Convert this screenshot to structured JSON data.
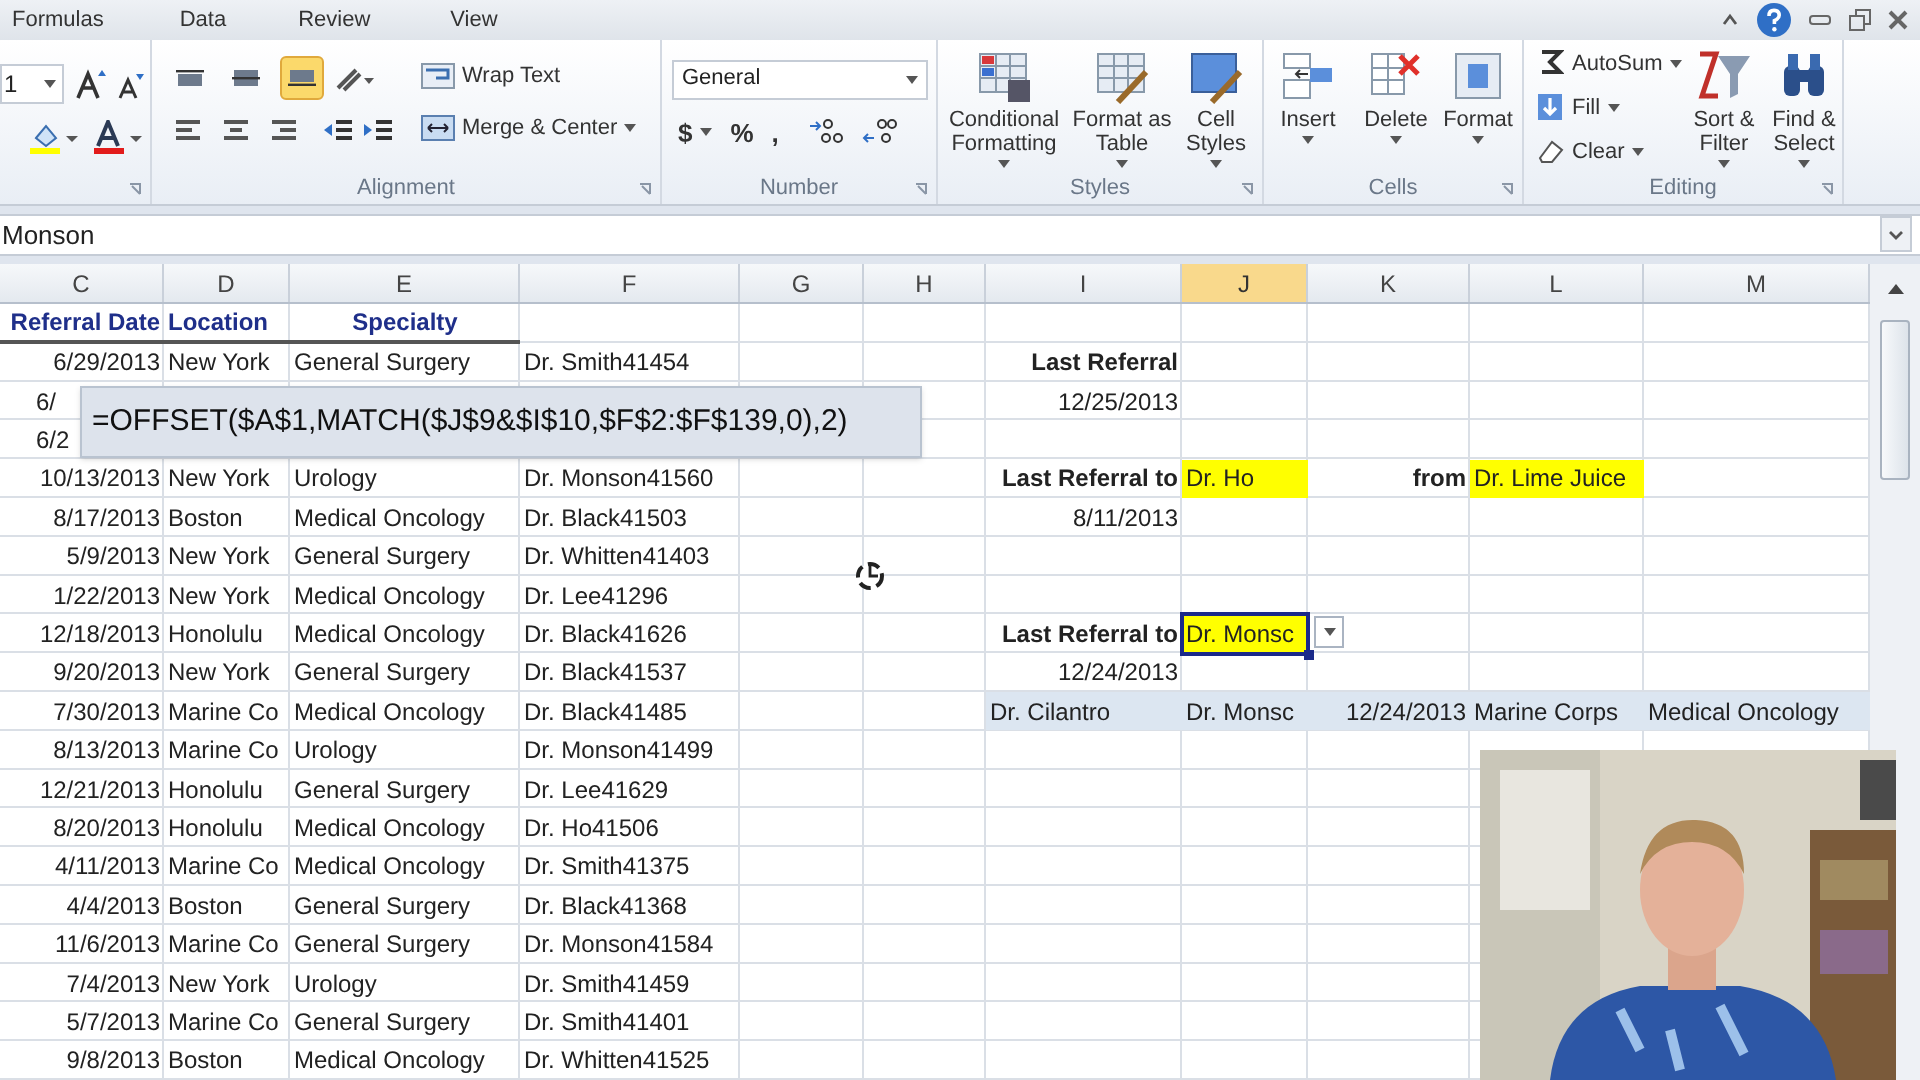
{
  "ribbon": {
    "tabs": [
      "Formulas",
      "Data",
      "Review",
      "View"
    ],
    "font": {
      "size": "1"
    },
    "alignment": {
      "label": "Alignment",
      "vertical": [
        {
          "selected": false
        },
        {
          "selected": false
        },
        {
          "selected": true
        }
      ],
      "wrap": "Wrap Text",
      "merge": "Merge & Center"
    },
    "number": {
      "label": "Number",
      "format": "General",
      "symbols": [
        "$",
        "%",
        ","
      ]
    },
    "styles": {
      "label": "Styles",
      "buttons": [
        "Conditional Formatting",
        "Format as Table",
        "Cell Styles"
      ]
    },
    "cells": {
      "label": "Cells",
      "buttons": [
        "Insert",
        "Delete",
        "Format"
      ]
    },
    "editing": {
      "label": "Editing",
      "small": [
        "AutoSum",
        "Fill",
        "Clear"
      ],
      "big": [
        "Sort & Filter",
        "Find & Select"
      ]
    }
  },
  "formula_bar": {
    "value": "Monson"
  },
  "sheet": {
    "columns": [
      {
        "letter": "C",
        "selected": false
      },
      {
        "letter": "D",
        "selected": false
      },
      {
        "letter": "E",
        "selected": false
      },
      {
        "letter": "F",
        "selected": false
      },
      {
        "letter": "G",
        "selected": false
      },
      {
        "letter": "H",
        "selected": false
      },
      {
        "letter": "I",
        "selected": false
      },
      {
        "letter": "J",
        "selected": true
      },
      {
        "letter": "K",
        "selected": false
      },
      {
        "letter": "L",
        "selected": false
      },
      {
        "letter": "M",
        "selected": false
      }
    ],
    "header": [
      "Referral Date",
      "Location",
      "Specialty"
    ],
    "rows": [
      {
        "left": [
          "6/29/2013",
          "New York",
          "General Surgery",
          "Dr. Smith41454"
        ],
        "right": {
          "I": {
            "text": "Last Referral",
            "kind": "label"
          }
        }
      },
      {
        "left": [
          "6/"
        ],
        "covered": true,
        "right": {
          "I": {
            "text": "12/25/2013",
            "kind": "date"
          }
        }
      },
      {
        "left": [
          "6/2"
        ],
        "covered": true
      },
      {
        "left": [
          "10/13/2013",
          "New York",
          "Urology",
          "Dr. Monson41560"
        ],
        "right": {
          "I": {
            "text": "Last Referral to",
            "kind": "label"
          },
          "J": {
            "text": "Dr. Ho",
            "kind": "highlight"
          },
          "K": {
            "text": "from",
            "kind": "label"
          },
          "L": {
            "text": "Dr. Lime Juice",
            "kind": "highlight"
          }
        }
      },
      {
        "left": [
          "8/17/2013",
          "Boston",
          "Medical Oncology",
          "Dr. Black41503"
        ],
        "right": {
          "I": {
            "text": "8/11/2013",
            "kind": "date"
          }
        }
      },
      {
        "left": [
          "5/9/2013",
          "New York",
          "General Surgery",
          "Dr. Whitten41403"
        ]
      },
      {
        "left": [
          "1/22/2013",
          "New York",
          "Medical Oncology",
          "Dr. Lee41296"
        ]
      },
      {
        "left": [
          "12/18/2013",
          "Honolulu",
          "Medical Oncology",
          "Dr. Black41626"
        ],
        "right": {
          "I": {
            "text": "Last Referral to",
            "kind": "label"
          },
          "J": {
            "text": "Dr. Monsc",
            "kind": "highlight",
            "selected": true
          }
        }
      },
      {
        "left": [
          "9/20/2013",
          "New York",
          "General Surgery",
          "Dr. Black41537"
        ],
        "right": {
          "I": {
            "text": "12/24/2013",
            "kind": "date"
          }
        }
      },
      {
        "left": [
          "7/30/2013",
          "Marine Co",
          "Medical Oncology",
          "Dr. Black41485"
        ],
        "shaded": true,
        "right": {
          "I": {
            "text": "Dr. Cilantro",
            "kind": "text"
          },
          "J": {
            "text": "Dr. Monsc",
            "kind": "text"
          },
          "K": {
            "text": "12/24/2013",
            "kind": "date"
          },
          "L": {
            "text": "Marine Corps",
            "kind": "text"
          },
          "M": {
            "text": "Medical Oncology",
            "kind": "text"
          }
        }
      },
      {
        "left": [
          "8/13/2013",
          "Marine Co",
          "Urology",
          "Dr. Monson41499"
        ]
      },
      {
        "left": [
          "12/21/2013",
          "Honolulu",
          "General Surgery",
          "Dr. Lee41629"
        ]
      },
      {
        "left": [
          "8/20/2013",
          "Honolulu",
          "Medical Oncology",
          "Dr. Ho41506"
        ]
      },
      {
        "left": [
          "4/11/2013",
          "Marine Co",
          "Medical Oncology",
          "Dr. Smith41375"
        ]
      },
      {
        "left": [
          "4/4/2013",
          "Boston",
          "General Surgery",
          "Dr. Black41368"
        ]
      },
      {
        "left": [
          "11/6/2013",
          "Marine Co",
          "General Surgery",
          "Dr. Monson41584"
        ]
      },
      {
        "left": [
          "7/4/2013",
          "New York",
          "Urology",
          "Dr. Smith41459"
        ]
      },
      {
        "left": [
          "5/7/2013",
          "Marine Co",
          "General Surgery",
          "Dr. Smith41401"
        ]
      },
      {
        "left": [
          "9/8/2013",
          "Boston",
          "Medical Oncology",
          "Dr. Whitten41525"
        ]
      }
    ]
  },
  "formula_tooltip": "=OFFSET($A$1,MATCH($J$9&$I$10,$F$2:$F$139,0),2)"
}
